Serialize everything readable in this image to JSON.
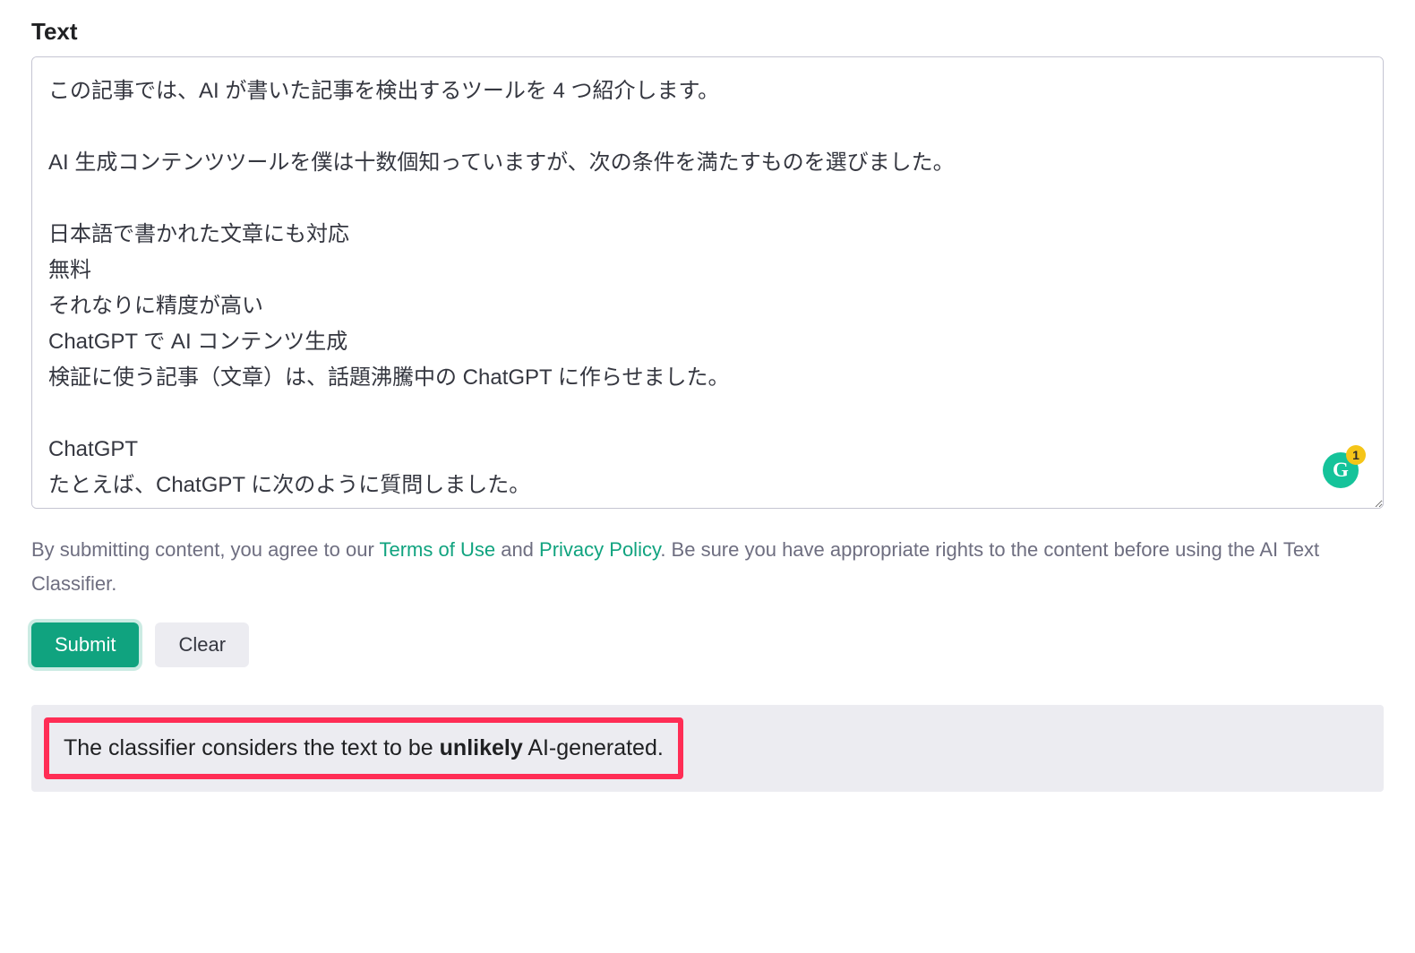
{
  "label": "Text",
  "textarea_value": "この記事では、AI が書いた記事を検出するツールを 4 つ紹介します。\n\nAI 生成コンテンツツールを僕は十数個知っていますが、次の条件を満たすものを選びました。\n\n日本語で書かれた文章にも対応\n無料\nそれなりに精度が高い\nChatGPT で AI コンテンツ生成\n検証に使う記事（文章）は、話題沸騰中の ChatGPT に作らせました。\n\nChatGPT\nたとえば、ChatGPT に次のように質問しました。",
  "grammarly": {
    "count": "1",
    "glyph": "G"
  },
  "disclaimer": {
    "prefix": "By submitting content, you agree to our ",
    "terms_link": "Terms of Use",
    "middle": " and ",
    "privacy_link": "Privacy Policy",
    "suffix": ". Be sure you have appropriate rights to the content before using the AI Text Classifier."
  },
  "buttons": {
    "submit": "Submit",
    "clear": "Clear"
  },
  "result": {
    "prefix": "The classifier considers the text to be ",
    "verdict": "unlikely",
    "suffix": " AI-generated."
  }
}
